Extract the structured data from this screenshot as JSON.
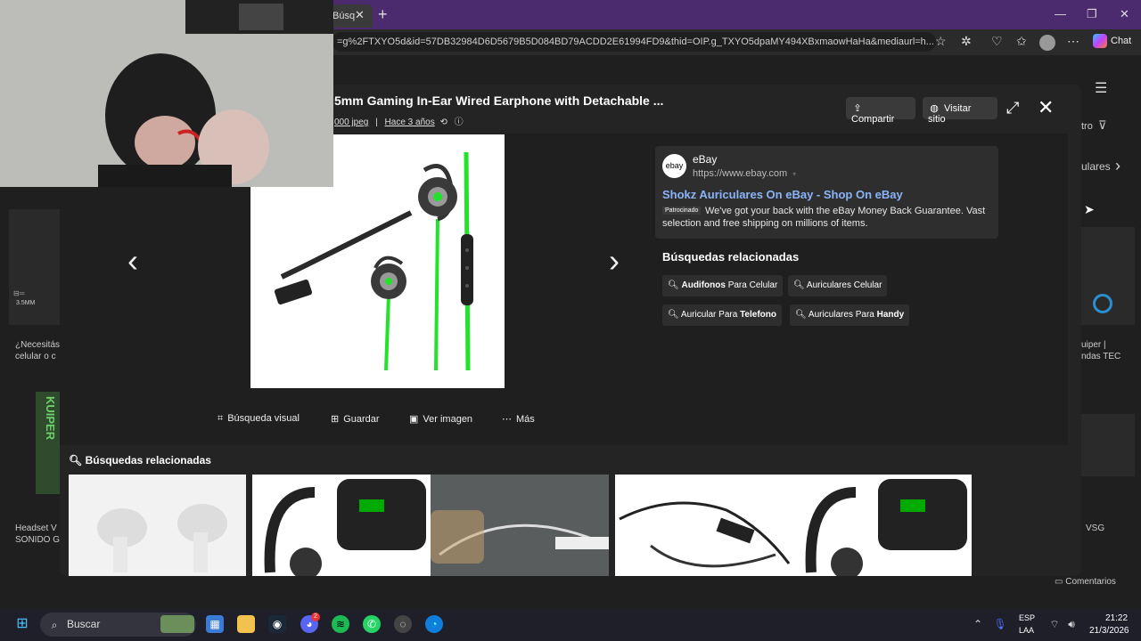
{
  "browser": {
    "tab_title": "Búsq",
    "url": "=g%2FTXYO5d&id=57DB32984D6D5679B5D084BD79ACDD2E61994FD9&thid=OIP.g_TXYO5dpaMY494XBxmaowHaHa&mediaurl=h...",
    "chat_label": "Chat"
  },
  "background": {
    "left_text_1": "¿Necesitás",
    "left_text_2": "celular o c",
    "right_text_1": "uiper |",
    "right_text_2": "ndas TEC",
    "bottom_left_1": "Headset V",
    "bottom_left_2": "SONIDO G",
    "bottom_right": "VSG",
    "plug_label": "3.5MM",
    "side_brand": "KUIPER",
    "filter_label": "tro",
    "pill_label": "ulares",
    "comments_label": "Comentarios"
  },
  "modal": {
    "title": "5mm Gaming In-Ear Wired Earphone with Detachable ...",
    "meta_size": "000 jpeg",
    "meta_sep": "|",
    "meta_age": "Hace 3 años",
    "share_label": "Compartir",
    "visit_label": "Visitar sitio"
  },
  "tools": {
    "visual_search": "Búsqueda visual",
    "save": "Guardar",
    "view_image": "Ver imagen",
    "more": "Más"
  },
  "ad": {
    "site_name": "eBay",
    "site_url": "https://www.ebay.com",
    "logo_text": "ebay",
    "title": "Shokz Auriculares On eBay - Shop On eBay",
    "tag": "Patrocinado",
    "description": "We've got your back with the eBay Money Back Guarantee. Vast selection and free shipping on millions of items."
  },
  "related": {
    "heading": "Búsquedas relacionadas",
    "chip1_bold": "Audifonos",
    "chip1_rest": " Para Celular",
    "chip2": "Auriculares Celular",
    "chip3_rest": "Auricular Para ",
    "chip3_bold": "Telefono",
    "chip4_rest": "Auriculares Para ",
    "chip4_bold": "Handy"
  },
  "related_bottom": {
    "heading": "Búsquedas relacionadas"
  },
  "taskbar": {
    "search_label": "Buscar",
    "lang_1": "ESP",
    "lang_2": "LAA",
    "time": "21:22",
    "date": "21/3/2026",
    "discord_badge": "2"
  },
  "colors": {
    "accent_link": "#8ab4f8",
    "titlebar": "#4b2a6e",
    "earphone_cable": "#22e22a"
  }
}
